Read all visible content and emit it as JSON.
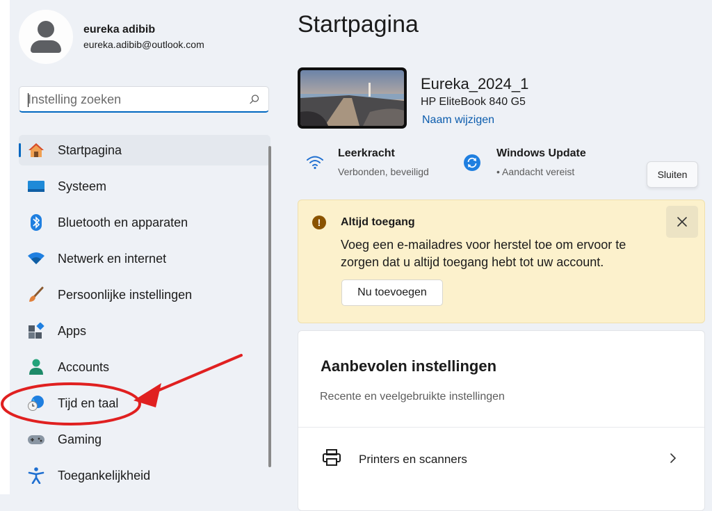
{
  "profile": {
    "name": "eureka adibib",
    "email": "eureka.adibib@outlook.com"
  },
  "search": {
    "placeholder": "Instelling zoeken"
  },
  "nav": {
    "items": [
      {
        "label": "Startpagina",
        "icon": "home-icon",
        "active": true
      },
      {
        "label": "Systeem",
        "icon": "system-icon"
      },
      {
        "label": "Bluetooth en apparaten",
        "icon": "bluetooth-icon"
      },
      {
        "label": "Netwerk en internet",
        "icon": "network-icon"
      },
      {
        "label": "Persoonlijke instellingen",
        "icon": "brush-icon"
      },
      {
        "label": "Apps",
        "icon": "apps-icon"
      },
      {
        "label": "Accounts",
        "icon": "accounts-icon"
      },
      {
        "label": "Tijd en taal",
        "icon": "time-language-icon"
      },
      {
        "label": "Gaming",
        "icon": "gaming-icon"
      },
      {
        "label": "Toegankelijkheid",
        "icon": "accessibility-icon"
      }
    ]
  },
  "main": {
    "title": "Startpagina",
    "device": {
      "name": "Eureka_2024_1",
      "model": "HP EliteBook 840 G5",
      "rename_link": "Naam wijzigen"
    },
    "status": {
      "wifi_title": "Leerkracht",
      "wifi_status": "Verbonden, beveiligd",
      "update_title": "Windows Update",
      "update_status": "• Aandacht vereist"
    },
    "tooltip": "Sluiten",
    "banner": {
      "title": "Altijd toegang",
      "text": "Voeg een e-mailadres voor herstel toe om ervoor te zorgen dat u altijd toegang hebt tot uw account.",
      "button": "Nu toevoegen"
    },
    "recommended": {
      "title": "Aanbevolen instellingen",
      "subtitle": "Recente en veelgebruikte instellingen",
      "rows": [
        {
          "label": "Printers en scanners",
          "icon": "printer-icon"
        }
      ]
    }
  },
  "colors": {
    "accent": "#0067c0",
    "link": "#0b5cad",
    "banner_bg": "#fcf1cc",
    "annotation": "#e02020"
  }
}
